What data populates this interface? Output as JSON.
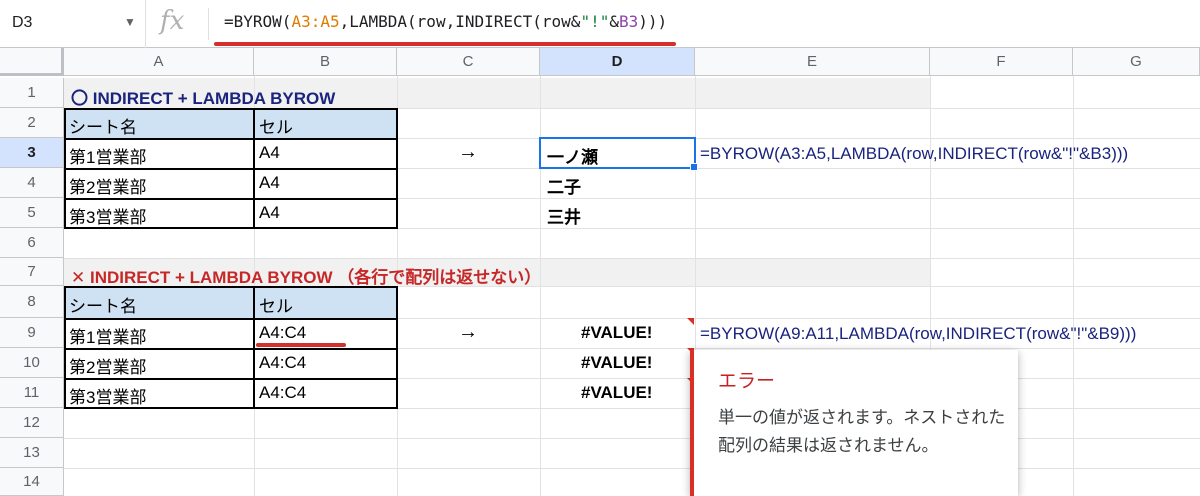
{
  "formula_bar": {
    "name_box": "D3",
    "fx_label": "fx",
    "formula_parts": [
      "=BYROW(",
      "A3:A5",
      ",LAMBDA(row,INDIRECT(row&",
      "\"!\"",
      "&",
      "B3",
      ")))"
    ]
  },
  "columns": [
    "A",
    "B",
    "C",
    "D",
    "E",
    "F",
    "G"
  ],
  "rows": [
    "1",
    "2",
    "3",
    "4",
    "5",
    "6",
    "7",
    "8",
    "9",
    "10",
    "11",
    "12",
    "13",
    "14"
  ],
  "section1": {
    "title": "〇 INDIRECT + LAMBDA BYROW",
    "header": [
      "シート名",
      "セル"
    ],
    "rows": [
      [
        "第1営業部",
        "A4"
      ],
      [
        "第2営業部",
        "A4"
      ],
      [
        "第3営業部",
        "A4"
      ]
    ],
    "arrow": "→",
    "results": [
      "一ノ瀬",
      "二子",
      "三井"
    ],
    "formula_note": "=BYROW(A3:A5,LAMBDA(row,INDIRECT(row&\"!\"&B3)))"
  },
  "section2": {
    "title": "✕ INDIRECT + LAMBDA BYROW （各行で配列は返せない）",
    "header": [
      "シート名",
      "セル"
    ],
    "rows": [
      [
        "第1営業部",
        "A4:C4"
      ],
      [
        "第2営業部",
        "A4:C4"
      ],
      [
        "第3営業部",
        "A4:C4"
      ]
    ],
    "arrow": "→",
    "results": [
      "#VALUE!",
      "#VALUE!",
      "#VALUE!"
    ],
    "formula_note": "=BYROW(A9:A11,LAMBDA(row,INDIRECT(row&\"!\"&B9)))"
  },
  "tooltip": {
    "title": "エラー",
    "body": "単一の値が返されます。ネストされた配列の結果は返されません。"
  },
  "colors": {
    "accent_blue": "#1a73e8",
    "header_fill": "#cfe2f3",
    "error_red": "#d93025",
    "title_blue": "#1a237e",
    "title_red": "#c62828"
  }
}
